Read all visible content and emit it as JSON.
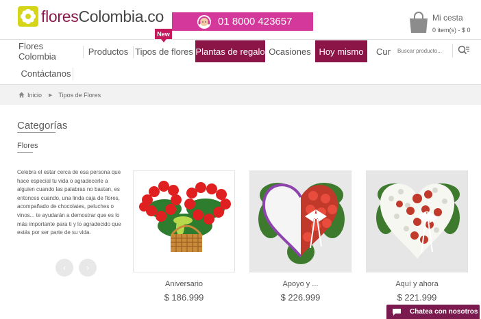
{
  "header": {
    "logo_part1": "flores",
    "logo_part2": "Colombia",
    "logo_part3": ".co",
    "phone": "01 8000 423657",
    "cart_title": "Mi cesta",
    "cart_info": "0 item(s) - $ 0"
  },
  "nav": {
    "items": [
      {
        "label": "Flores Colombia"
      },
      {
        "label": "Productos"
      },
      {
        "label": "Tipos de flores"
      },
      {
        "label": "Plantas de regalo"
      },
      {
        "label": "Ocasiones"
      },
      {
        "label": "Hoy mismo"
      },
      {
        "label": "Cum"
      }
    ],
    "new_badge": "New",
    "contact": "Contáctanos",
    "search_placeholder": "Buscar producto..."
  },
  "breadcrumb": {
    "home": "Inicio",
    "current": "Tipos de Flores"
  },
  "sidebar": {
    "title": "Categorías",
    "subtitle": "Flores",
    "description": "Celebra el estar cerca de esa persona que hace especial tu vida o agradecerle a alguien cuando las palabras no bastan, es entonces cuando, una linda caja de flores, acompañado de chocolates, peluches o vinos... te ayudarán a demostrar que es lo más importante para ti y lo agradecido que estás por ser parte de su vida.",
    "prev_arrow": "‹",
    "next_arrow": "›"
  },
  "products": [
    {
      "name": "Aniversario",
      "price": "$ 186.999"
    },
    {
      "name": "Apoyo y ...",
      "price": "$ 226.999"
    },
    {
      "name": "Aquí y ahora",
      "price": "$ 221.999"
    }
  ],
  "chat": {
    "label": "Chatea con nosotros"
  },
  "colors": {
    "brand_dark": "#8c1547",
    "phone_pink": "#d4389b",
    "logo_yellow": "#d6d51c"
  }
}
